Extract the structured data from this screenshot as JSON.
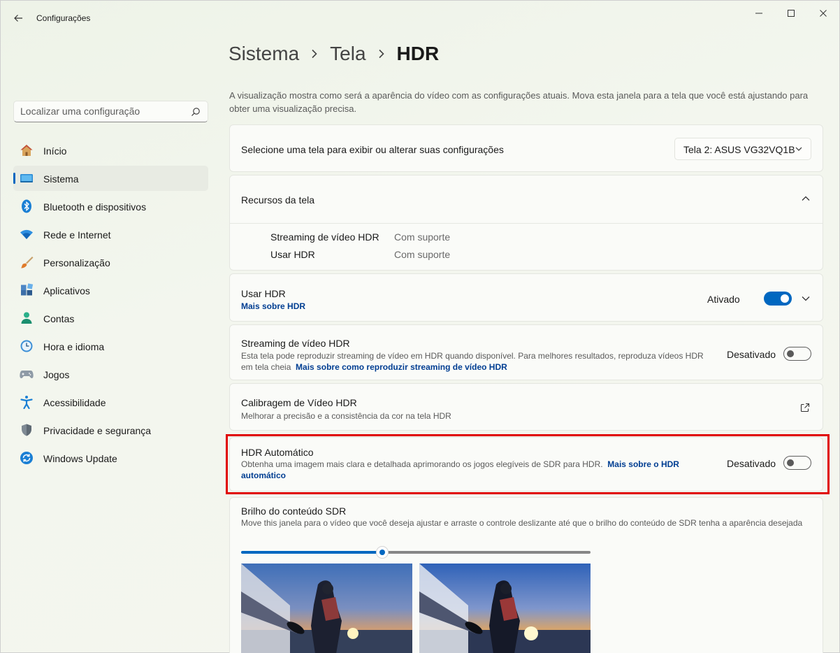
{
  "app": {
    "title": "Configurações"
  },
  "search": {
    "placeholder": "Localizar uma configuração"
  },
  "sidebar": {
    "items": [
      {
        "label": "Início",
        "icon": "home-icon"
      },
      {
        "label": "Sistema",
        "icon": "system-icon",
        "active": true
      },
      {
        "label": "Bluetooth e dispositivos",
        "icon": "bluetooth-icon"
      },
      {
        "label": "Rede e Internet",
        "icon": "wifi-icon"
      },
      {
        "label": "Personalização",
        "icon": "brush-icon"
      },
      {
        "label": "Aplicativos",
        "icon": "apps-icon"
      },
      {
        "label": "Contas",
        "icon": "account-icon"
      },
      {
        "label": "Hora e idioma",
        "icon": "clock-globe-icon"
      },
      {
        "label": "Jogos",
        "icon": "gamepad-icon"
      },
      {
        "label": "Acessibilidade",
        "icon": "accessibility-icon"
      },
      {
        "label": "Privacidade e segurança",
        "icon": "shield-icon"
      },
      {
        "label": "Windows Update",
        "icon": "update-icon"
      }
    ]
  },
  "breadcrumb": {
    "item1": "Sistema",
    "item2": "Tela",
    "current": "HDR"
  },
  "intro": "A visualização mostra como será a aparência do vídeo com as configurações atuais. Mova esta janela para a tela que você está ajustando para obter uma visualização precisa.",
  "display_select": {
    "label": "Selecione uma tela para exibir ou alterar suas configurações",
    "value": "Tela 2: ASUS VG32VQ1B"
  },
  "capabilities": {
    "title": "Recursos da tela",
    "rows": [
      {
        "name": "Streaming de vídeo HDR",
        "value": "Com suporte"
      },
      {
        "name": "Usar HDR",
        "value": "Com suporte"
      }
    ]
  },
  "use_hdr": {
    "title": "Usar HDR",
    "link": "Mais sobre HDR",
    "state": "Ativado",
    "on": true
  },
  "hdr_streaming": {
    "title": "Streaming de vídeo HDR",
    "desc": "Esta tela pode reproduzir streaming de vídeo em HDR quando disponível. Para melhores resultados, reproduza vídeos HDR em tela cheia",
    "link": "Mais sobre como reproduzir streaming de vídeo HDR",
    "state": "Desativado",
    "on": false
  },
  "calibration": {
    "title": "Calibragem de Vídeo HDR",
    "desc": "Melhorar a precisão e a consistência da cor na tela HDR"
  },
  "auto_hdr": {
    "title": "HDR Automático",
    "desc": "Obtenha uma imagem mais clara e detalhada aprimorando os jogos elegíveis de SDR para HDR.",
    "link": "Mais sobre o HDR automático",
    "state": "Desativado",
    "on": false
  },
  "sdr_brightness": {
    "title": "Brilho do conteúdo SDR",
    "desc": "Move this janela para o vídeo que você deseja ajustar e arraste o controle deslizante até que o brilho do conteúdo de SDR tenha a aparência desejada",
    "slider_value_fraction": 0.4
  },
  "colors": {
    "accent": "#0067c0",
    "link": "#003e92",
    "highlight": "#e00000"
  }
}
